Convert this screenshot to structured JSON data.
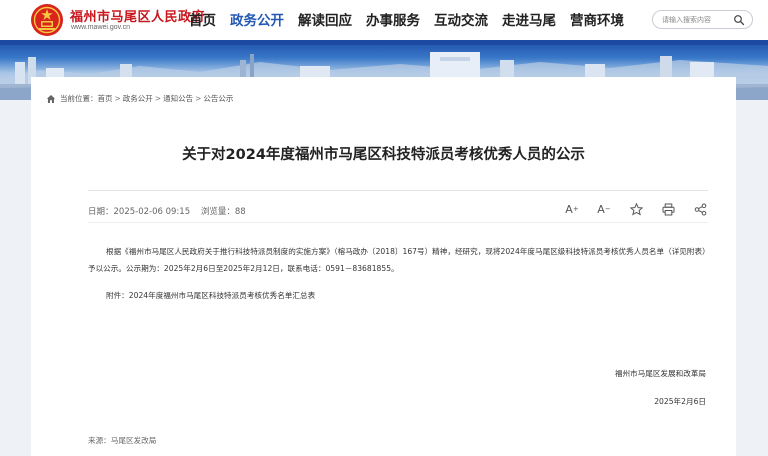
{
  "header": {
    "site_name": "福州市马尾区人民政府",
    "site_url": "www.mawei.gov.cn",
    "nav": [
      {
        "label": "首页",
        "active": false
      },
      {
        "label": "政务公开",
        "active": true
      },
      {
        "label": "解读回应",
        "active": false
      },
      {
        "label": "办事服务",
        "active": false
      },
      {
        "label": "互动交流",
        "active": false
      },
      {
        "label": "走进马尾",
        "active": false
      },
      {
        "label": "营商环境",
        "active": false
      }
    ],
    "search_placeholder": "请输入搜索内容",
    "accent_color": "#2458b3",
    "brand_color": "#c8161d"
  },
  "breadcrumb": {
    "prefix": "当前位置：",
    "items": [
      "首页",
      "政务公开",
      "通知公告",
      "公告公示"
    ],
    "separator": ">"
  },
  "article": {
    "title": "关于对2024年度福州市马尾区科技特派员考核优秀人员的公示",
    "date_label": "日期：2025-02-06 09:15",
    "views_label": "浏览量：88",
    "body": "根据《福州市马尾区人民政府关于推行科技特派员制度的实施方案》（榕马政办〔2018〕167号）精神，经研究，现将2024年度马尾区级科技特派员考核优秀人员名单（详见附表）予以公示。公示期为：2025年2月6日至2025年2月12日，联系电话：0591－83681855。",
    "attachment": "附件：2024年度福州市马尾区科技特派员考核优秀名单汇总表",
    "signature": "福州市马尾区发展和改革局",
    "sign_date": "2025年2月6日",
    "source": "来源：马尾区发改局"
  },
  "tools": [
    {
      "name": "font-increase",
      "glyph": "A",
      "sup": "+"
    },
    {
      "name": "font-decrease",
      "glyph": "A",
      "sup": "−"
    },
    {
      "name": "favorite",
      "glyph": "☆"
    },
    {
      "name": "print",
      "glyph": "print"
    },
    {
      "name": "share",
      "glyph": "share"
    }
  ]
}
